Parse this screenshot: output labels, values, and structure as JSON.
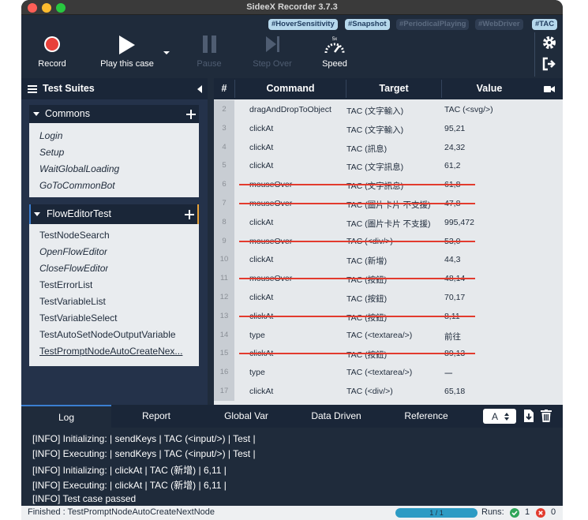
{
  "window": {
    "title": "SideeX Recorder 3.7.3"
  },
  "colors": {
    "accent": "#3b7fd1",
    "record": "#e8413a",
    "strike": "#e23b2e",
    "ok": "#2fa55a",
    "error": "#e23b2e",
    "progress": "#2c9bc4"
  },
  "tags": [
    {
      "label": "#HoverSensitivity",
      "active": true
    },
    {
      "label": "#Snapshot",
      "active": true
    },
    {
      "label": "#PeriodicalPlaying",
      "active": false
    },
    {
      "label": "#WebDriver",
      "active": false
    },
    {
      "label": "#TAC",
      "active": true
    }
  ],
  "toolbar": {
    "record_label": "Record",
    "play_label": "Play this case",
    "pause_label": "Pause",
    "stepover_label": "Step Over",
    "speed_label": "Speed",
    "speed_value": "5x"
  },
  "sidebar": {
    "title": "Test Suites",
    "suites": [
      {
        "name": "Commons",
        "cases": [
          {
            "name": "Login",
            "italic": true
          },
          {
            "name": "Setup",
            "italic": true
          },
          {
            "name": "WaitGlobalLoading",
            "italic": true
          },
          {
            "name": "GoToCommonBot",
            "italic": true
          }
        ]
      },
      {
        "name": "FlowEditorTest",
        "cases": [
          {
            "name": "TestNodeSearch",
            "italic": false
          },
          {
            "name": "OpenFlowEditor",
            "italic": true
          },
          {
            "name": "CloseFlowEditor",
            "italic": true
          },
          {
            "name": "TestErrorList",
            "italic": false
          },
          {
            "name": "TestVariableList",
            "italic": false
          },
          {
            "name": "TestVariableSelect",
            "italic": false
          },
          {
            "name": "TestAutoSetNodeOutputVariable",
            "italic": false
          },
          {
            "name": "TestPromptNodeAutoCreateNex...",
            "italic": false,
            "selected": true
          }
        ]
      }
    ]
  },
  "grid": {
    "headers": {
      "num": "#",
      "command": "Command",
      "target": "Target",
      "value": "Value"
    },
    "rows": [
      {
        "num": "2",
        "command": "dragAndDropToObject",
        "target": "TAC (文字輸入)",
        "value": "TAC (<svg/>)",
        "disabled": false
      },
      {
        "num": "3",
        "command": "clickAt",
        "target": "TAC (文字輸入)",
        "value": "95,21",
        "disabled": false
      },
      {
        "num": "4",
        "command": "clickAt",
        "target": "TAC (訊息)",
        "value": "24,32",
        "disabled": false
      },
      {
        "num": "5",
        "command": "clickAt",
        "target": "TAC (文字訊息)",
        "value": "61,2",
        "disabled": false
      },
      {
        "num": "6",
        "command": "mouseOver",
        "target": "TAC (文字訊息)",
        "value": "61,8",
        "disabled": true
      },
      {
        "num": "7",
        "command": "mouseOver",
        "target": "TAC (圖片卡片 不支援)",
        "value": "47,8",
        "disabled": true
      },
      {
        "num": "8",
        "command": "clickAt",
        "target": "TAC (圖片卡片 不支援)",
        "value": "995,472",
        "disabled": false
      },
      {
        "num": "9",
        "command": "mouseOver",
        "target": "TAC (<div/>)",
        "value": "53,0",
        "disabled": true
      },
      {
        "num": "10",
        "command": "clickAt",
        "target": "TAC (新增)",
        "value": "44,3",
        "disabled": false
      },
      {
        "num": "11",
        "command": "mouseOver",
        "target": "TAC (按鈕)",
        "value": "48,14",
        "disabled": true
      },
      {
        "num": "12",
        "command": "clickAt",
        "target": "TAC (按鈕)",
        "value": "70,17",
        "disabled": false
      },
      {
        "num": "13",
        "command": "clickAt",
        "target": "TAC (按鈕)",
        "value": "8,11",
        "disabled": true
      },
      {
        "num": "14",
        "command": "type",
        "target": "TAC (<textarea/>)",
        "value": "前往",
        "disabled": false
      },
      {
        "num": "15",
        "command": "clickAt",
        "target": "TAC (按鈕)",
        "value": "89,13",
        "disabled": true
      },
      {
        "num": "16",
        "command": "type",
        "target": "TAC (<textarea/>)",
        "value": "一",
        "disabled": false
      },
      {
        "num": "17",
        "command": "clickAt",
        "target": "TAC (<div/>)",
        "value": "65,18",
        "disabled": false
      }
    ]
  },
  "bottom": {
    "tabs": [
      "Log",
      "Report",
      "Global Var",
      "Data Driven",
      "Reference"
    ],
    "active_tab": "Log",
    "font_select": "A",
    "log": [
      "[INFO] Initializing: | sendKeys | TAC (<input/>) | Test |",
      "[INFO] Executing: | sendKeys | TAC (<input/>) | Test |",
      "[INFO] Initializing: | clickAt | TAC (新增) | 6,11 |",
      "[INFO] Executing: | clickAt | TAC (新增) | 6,11 |",
      "[INFO] Test case passed"
    ]
  },
  "status": {
    "finished": "Finished : TestPromptNodeAutoCreateNextNode",
    "progress_text": "1 / 1",
    "progress_fraction": 1.0,
    "runs_label": "Runs:",
    "pass_count": "1",
    "fail_count": "0"
  }
}
